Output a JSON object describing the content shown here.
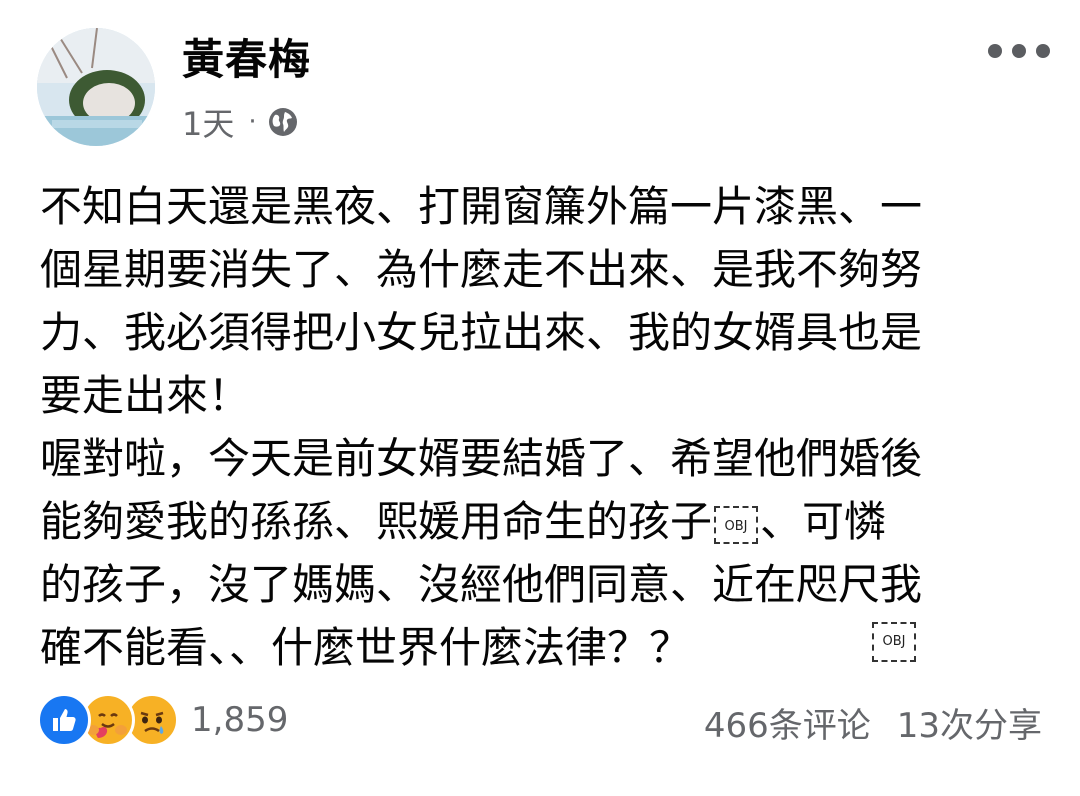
{
  "author": {
    "name": "黃春梅",
    "time": "1天",
    "separator": "·",
    "privacy_icon": "globe-icon"
  },
  "menu": {
    "icon": "more-options-icon"
  },
  "post": {
    "lines": [
      "不知白天還是黑夜、打開窗簾外篇一片漆黑、一",
      "個星期要消失了、為什麼走不出來、是我不夠努",
      "力、我必須得把小女兒拉出來、我的女婿具也是",
      "要走出來！",
      "喔對啦，今天是前女婿要結婚了、希望他們婚後",
      "能夠愛我的孫孫、熙媛用命生的孩子",
      "、可憐",
      "的孩子，沒了媽媽、沒經他們同意、近在咫尺我",
      "確不能看、、什麼世界什麼法律？？"
    ],
    "obj_label": "OBJ"
  },
  "footer": {
    "reactions": [
      "like-icon",
      "care-icon",
      "sad-icon"
    ],
    "reaction_count": "1,859",
    "comments": "466条评论",
    "shares": "13次分享"
  },
  "colors": {
    "text": "#050505",
    "secondary": "#65676b",
    "like_blue": "#1877f2",
    "emoji_yellow": "#f7b125"
  }
}
